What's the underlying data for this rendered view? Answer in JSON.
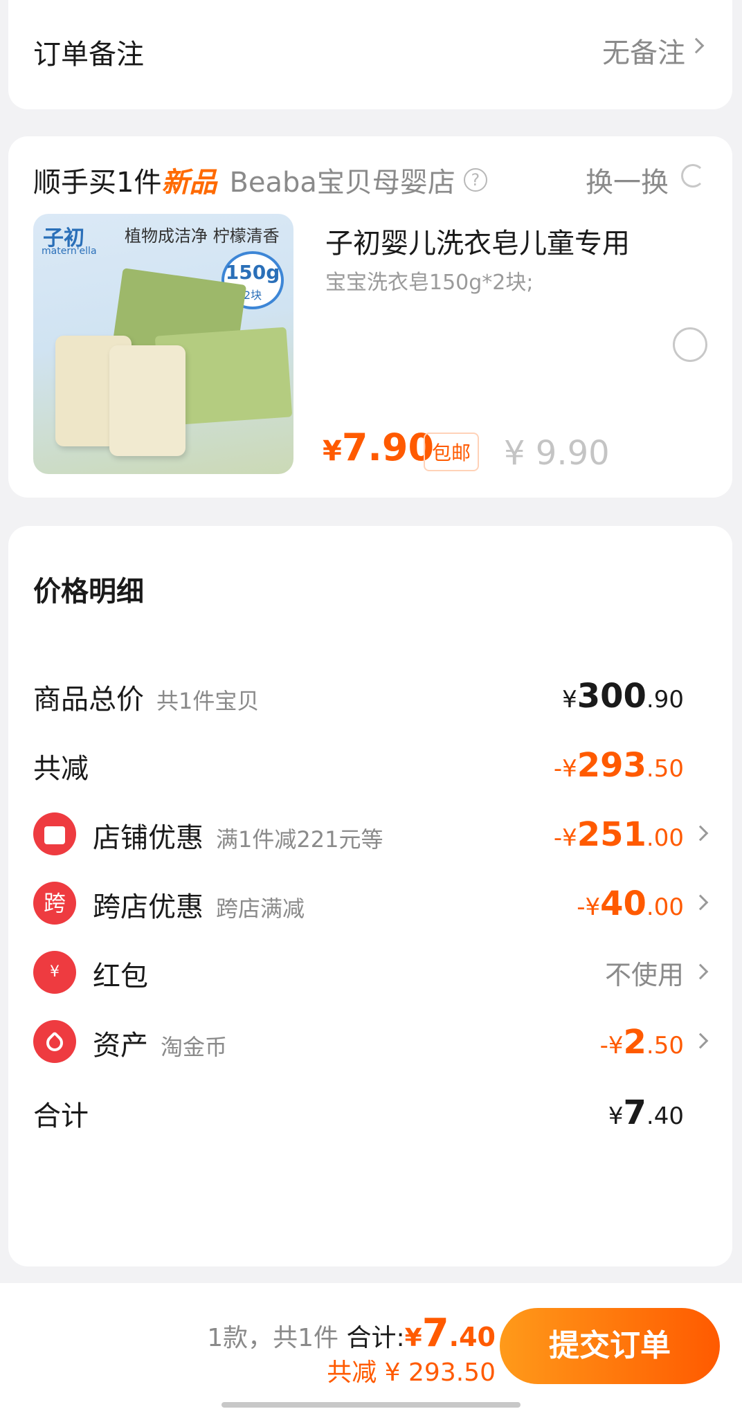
{
  "remark": {
    "label": "订单备注",
    "value": "无备注"
  },
  "addon": {
    "prefix": "顺手买1件",
    "new_tag": "新品",
    "shop": "Beaba宝贝母婴店",
    "help_glyph": "?",
    "swap_label": "换一换",
    "product": {
      "image_brand": "子初",
      "image_brand_en": "matern'ella",
      "image_slogan": "植物成洁净 柠檬清香",
      "image_weight": "150g",
      "image_count": "2块",
      "title": "子初婴儿洗衣皂儿童专用",
      "spec": "宝宝洗衣皂150g*2块;",
      "price_currency": "¥",
      "price": "7.90",
      "shipping_badge": "包邮",
      "original_price": "¥ 9.90"
    }
  },
  "details": {
    "title": "价格明细",
    "rows": [
      {
        "label": "商品总价",
        "sub": "共1件宝贝",
        "prefix": "¥",
        "int": "300",
        "dec": ".90",
        "color": "#1a1a1a"
      },
      {
        "label": "共减",
        "sub": "",
        "prefix": "-¥",
        "int": "293",
        "dec": ".50",
        "color": "#ff5a00"
      },
      {
        "label": "店铺优惠",
        "sub": "满1件减221元等",
        "prefix": "-¥",
        "int": "251",
        "dec": ".00",
        "color": "#ff5a00",
        "icon": "shop-icon"
      },
      {
        "label": "跨店优惠",
        "sub": "跨店满减",
        "prefix": "-¥",
        "int": "40",
        "dec": ".00",
        "color": "#ff5a00",
        "icon": "cross-store-icon",
        "icon_glyph": "跨"
      },
      {
        "label": "红包",
        "sub": "",
        "value": "不使用",
        "color": "#8a8a8a",
        "icon": "red-packet-icon",
        "icon_glyph": "¥"
      },
      {
        "label": "资产",
        "sub": "淘金币",
        "prefix": "-¥",
        "int": "2",
        "dec": ".50",
        "color": "#ff5a00",
        "icon": "coin-tag-icon"
      },
      {
        "label": "合计",
        "sub": "",
        "prefix": "¥",
        "int": "7",
        "dec": ".40",
        "color": "#1a1a1a"
      }
    ]
  },
  "bottom": {
    "count_text": "1款，共1件",
    "total_label": "合计:",
    "total_currency": "¥",
    "total_int": "7",
    "total_dec": ".40",
    "saved_text": "共减 ¥ 293.50",
    "submit_label": "提交订单"
  },
  "colors": {
    "accent": "#ff5a00",
    "icon_red": "#ee3b40"
  }
}
